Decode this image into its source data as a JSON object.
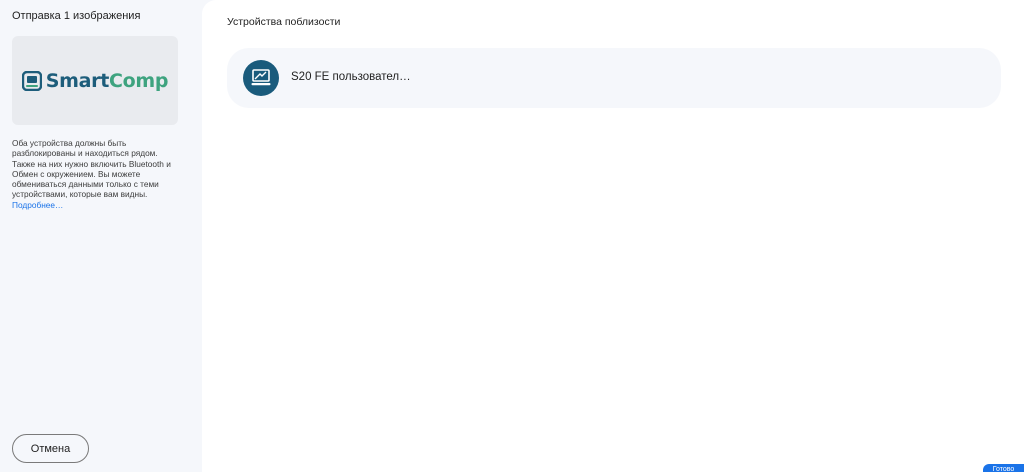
{
  "sidebar": {
    "title": "Отправка 1 изображения",
    "preview": {
      "logo_part1": "Smart",
      "logo_part2": "Comp"
    },
    "info_text": "Оба устройства должны быть разблокированы и находиться рядом. Также на них нужно включить Bluetooth и Обмен с окружением. Вы можете обмениваться данными только с теми устройствами, которые вам видны.",
    "info_link": "Подробнее…",
    "cancel_label": "Отмена"
  },
  "main": {
    "section_title": "Устройства поблизости",
    "devices": [
      {
        "name": "S20 FE пользовател…",
        "icon": "laptop-icon"
      }
    ]
  },
  "corner_button": {
    "label": "Готово"
  },
  "colors": {
    "accent": "#1a73e8",
    "device_icon_bg": "#1a5b7c",
    "logo_blue": "#1d5d7b",
    "logo_green": "#3ea37f"
  }
}
